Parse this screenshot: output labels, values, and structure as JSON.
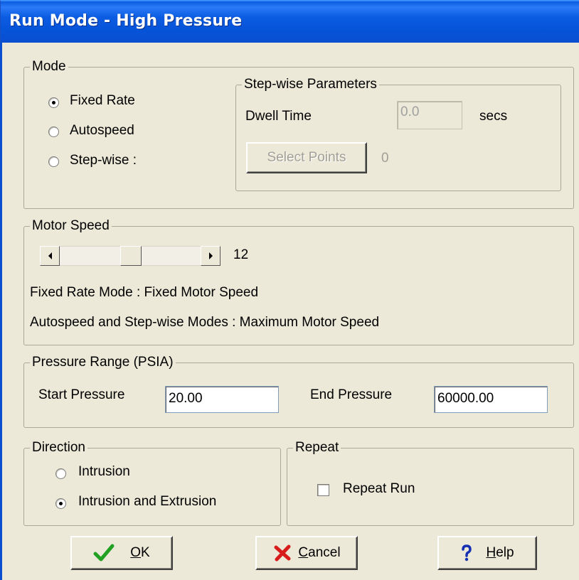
{
  "window": {
    "title": "Run Mode - High Pressure"
  },
  "mode": {
    "legend": "Mode",
    "options": [
      {
        "label": "Fixed Rate",
        "checked": true
      },
      {
        "label": "Autospeed",
        "checked": false
      },
      {
        "label": "Step-wise :",
        "checked": false
      }
    ],
    "stepwise": {
      "legend": "Step-wise Parameters",
      "dwell_label": "Dwell Time",
      "dwell_value": "0.0",
      "dwell_unit": "secs",
      "select_points_label": "Select Points",
      "points_count": "0"
    }
  },
  "motor": {
    "legend": "Motor Speed",
    "value": "12",
    "slider_fraction": 0.5,
    "note1": "Fixed Rate Mode : Fixed Motor Speed",
    "note2": "Autospeed and Step-wise Modes : Maximum Motor Speed"
  },
  "pressure": {
    "legend": "Pressure Range (PSIA)",
    "start_label": "Start Pressure",
    "start_value": "20.00",
    "end_label": "End Pressure",
    "end_value": "60000.00"
  },
  "direction": {
    "legend": "Direction",
    "options": [
      {
        "label": "Intrusion",
        "checked": false
      },
      {
        "label": "Intrusion and Extrusion",
        "checked": true
      }
    ]
  },
  "repeat": {
    "legend": "Repeat",
    "checkbox_label": "Repeat Run",
    "checked": false
  },
  "buttons": {
    "ok_mnemonic": "O",
    "ok_rest": "K",
    "cancel_mnemonic": "C",
    "cancel_rest": "ancel",
    "help_mnemonic": "H",
    "help_rest": "elp"
  },
  "colors": {
    "titlebar": "#0a5ae0",
    "dialog_bg": "#ece9d8",
    "ok_icon": "#22a022",
    "cancel_icon": "#d81c1c",
    "help_icon": "#1530b0"
  }
}
